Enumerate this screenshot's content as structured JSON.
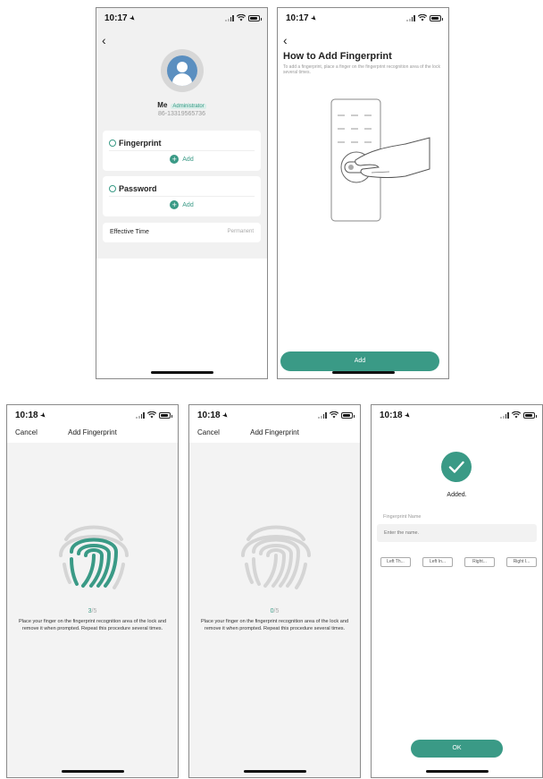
{
  "screens": {
    "s1": {
      "time": "10:17",
      "name": "Me",
      "role_badge": "Administrator",
      "phone": "86-13319565736",
      "fingerprint_title": "Fingerprint",
      "password_title": "Password",
      "add_label": "Add",
      "effective_label": "Effective Time",
      "effective_value": "Permanent"
    },
    "s2": {
      "time": "10:17",
      "heading": "How to Add Fingerprint",
      "subtext": "To add a fingerprint, place a finger on the fingerprint recognition area of the lock several times.",
      "add_button": "Add"
    },
    "s3": {
      "time": "10:18",
      "cancel": "Cancel",
      "title": "Add Fingerprint",
      "progress_current": "3",
      "progress_total": "/5",
      "instruction": "Place your finger on the fingerprint recognition area of the lock and remove it when prompted. Repeat this procedure several times."
    },
    "s4": {
      "time": "10:18",
      "cancel": "Cancel",
      "title": "Add Fingerprint",
      "progress_current": "0",
      "progress_total": "/5",
      "instruction": "Place your finger on the fingerprint recognition area of the lock and remove it when prompted. Repeat this procedure several times."
    },
    "s5": {
      "time": "10:18",
      "added_text": "Added.",
      "name_label": "Fingerprint Name",
      "name_placeholder": "Enter the name.",
      "chips": [
        "Left Th...",
        "Left In...",
        "Right...",
        "Right I..."
      ],
      "ok_button": "OK"
    }
  },
  "colors": {
    "accent": "#3a9a86",
    "muted": "#999999",
    "bg": "#f1f1f1"
  },
  "icons": [
    "location-arrow-icon",
    "signal-icon",
    "wifi-icon",
    "battery-icon",
    "back-chevron-icon",
    "fingerprint-icon",
    "password-icon",
    "plus-circle-icon",
    "checkmark-icon",
    "avatar-icon"
  ]
}
